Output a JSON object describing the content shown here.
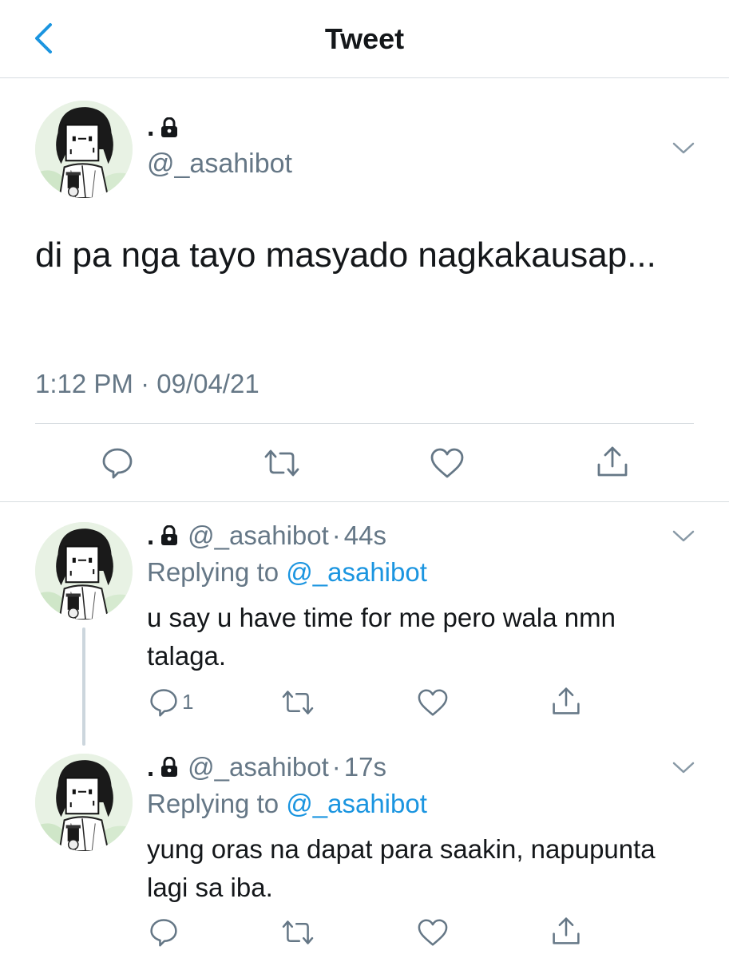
{
  "header": {
    "title": "Tweet"
  },
  "main_tweet": {
    "name": ".",
    "handle": "@_asahibot",
    "text": "di pa nga tayo masyado nagkakausap...",
    "timestamp": "1:12 PM · 09/04/21"
  },
  "replies": [
    {
      "name": ".",
      "handle": "@_asahibot",
      "dot": "·",
      "time": "44s",
      "replying_prefix": "Replying to ",
      "replying_to": "@_asahibot",
      "text": "u say u have time for me pero wala nmn talaga.",
      "reply_count": "1"
    },
    {
      "name": ".",
      "handle": "@_asahibot",
      "dot": "·",
      "time": "17s",
      "replying_prefix": "Replying to ",
      "replying_to": "@_asahibot",
      "text": "yung oras na dapat para saakin, napupunta lagi sa iba.",
      "reply_count": ""
    }
  ],
  "icons": {
    "back": "chevron-left-icon",
    "lock": "lock-icon",
    "more": "chevron-down-icon",
    "reply": "reply-icon",
    "retweet": "retweet-icon",
    "like": "heart-icon",
    "share": "share-icon"
  },
  "colors": {
    "accent": "#1b95e0",
    "secondary_text": "#657786",
    "icon_gray": "#657786",
    "divider": "#d8dde1",
    "thread_line": "#ccd6dd"
  }
}
